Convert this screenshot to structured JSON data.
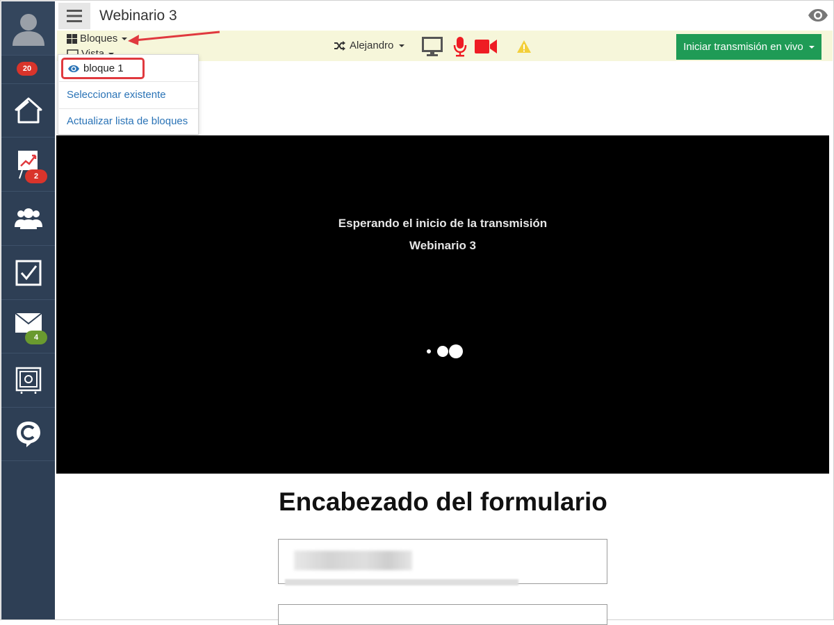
{
  "header": {
    "title": "Webinario 3"
  },
  "sidebar": {
    "notifications_badge": "20",
    "items": [
      {
        "name": "home",
        "icon": "home-icon"
      },
      {
        "name": "analytics",
        "icon": "presentation-chart-icon",
        "badge": "2"
      },
      {
        "name": "users",
        "icon": "users-group-icon"
      },
      {
        "name": "tasks",
        "icon": "checkbox-icon"
      },
      {
        "name": "mail",
        "icon": "envelope-icon",
        "badge": "4"
      },
      {
        "name": "safe",
        "icon": "safe-icon"
      },
      {
        "name": "chat",
        "icon": "c-chat-icon"
      }
    ]
  },
  "toolbar": {
    "bloques_label": "Bloques",
    "vista_label": "Vista",
    "presenter_label": "Alejandro",
    "live_button_label": "Iniciar transmisión en vivo"
  },
  "dropdown": {
    "selected_item": "bloque 1",
    "select_existing": "Seleccionar existente",
    "refresh_list": "Actualizar lista de bloques"
  },
  "video": {
    "status_line": "Esperando el inicio de la transmisión",
    "webinar_name": "Webinario 3"
  },
  "form": {
    "heading": "Encabezado del formulario"
  },
  "colors": {
    "sidebar_bg": "#2e3f55",
    "toolbar_bg": "#f6f6da",
    "live_button": "#1f9b56",
    "link": "#2a73b6",
    "highlight_red": "#e0393e",
    "badge_red": "#d9342b",
    "badge_green": "#6a9a2f"
  }
}
